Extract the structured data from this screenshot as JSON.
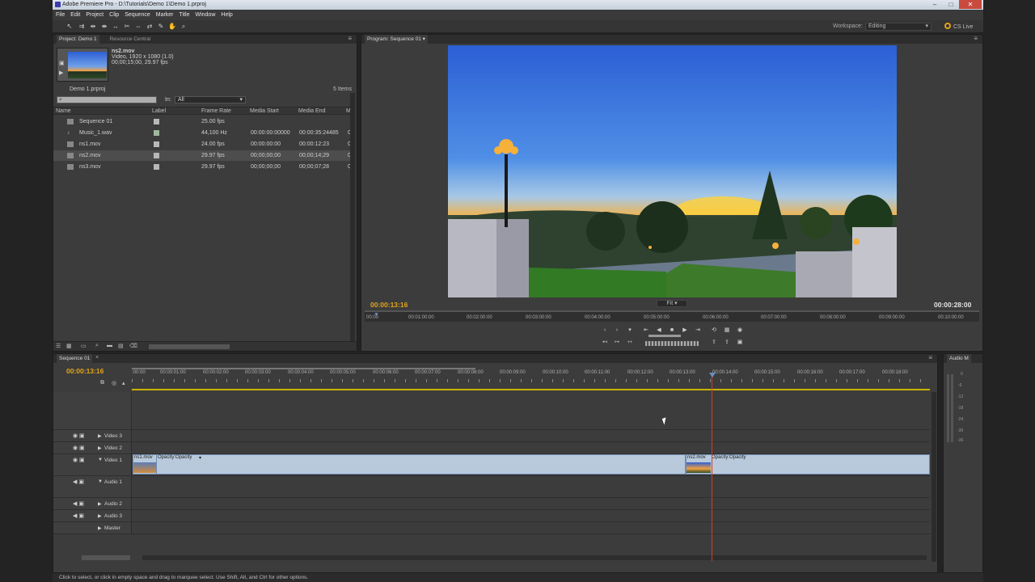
{
  "window": {
    "title": "Adobe Premiere Pro - D:\\Tutorials\\Demo 1\\Demo 1.prproj"
  },
  "menu": [
    "File",
    "Edit",
    "Project",
    "Clip",
    "Sequence",
    "Marker",
    "Title",
    "Window",
    "Help"
  ],
  "workspace": {
    "label": "Workspace:",
    "value": "Editing",
    "cs_live": "CS Live"
  },
  "project": {
    "tabs": [
      "Project: Demo 1",
      "Resource Central"
    ],
    "clip_info": {
      "name": "ns2.mov",
      "line1": "Video, 1920 x 1080 (1.0)",
      "line2": "00;00;15;00, 29.97 fps"
    },
    "project_file": "Demo 1.prproj",
    "item_count": "5 Items",
    "in_label": "In:",
    "in_value": "All",
    "columns": [
      "Name",
      "Label",
      "Frame Rate",
      "Media Start",
      "Media End",
      "M"
    ],
    "rows": [
      {
        "name": "Sequence 01",
        "rate": "25.00 fps",
        "start": "",
        "end": "",
        "m": ""
      },
      {
        "name": "Music_1.wav",
        "rate": "44,100 Hz",
        "start": "00:00:00:00000",
        "end": "00:00:35:24485",
        "m": "0"
      },
      {
        "name": "ns1.mov",
        "rate": "24.00 fps",
        "start": "00:00:00:00",
        "end": "00:00:12:23",
        "m": "0"
      },
      {
        "name": "ns2.mov",
        "rate": "29.97 fps",
        "start": "00;00;00;00",
        "end": "00;00;14;29",
        "m": "0"
      },
      {
        "name": "ns3.mov",
        "rate": "29.97 fps",
        "start": "00;00;00;00",
        "end": "00;00;07;28",
        "m": "0"
      }
    ]
  },
  "program": {
    "tab": "Program: Sequence 01",
    "timecode_current": "00:00:13:16",
    "timecode_duration": "00:00:28:00",
    "fit": "Fit",
    "ruler": [
      "00:00",
      "00:01:00:00",
      "00:02:00:00",
      "00:03:00:00",
      "00:04:00:00",
      "00:05:00:00",
      "00:06:00:00",
      "00:07:00:00",
      "00:08:00:00",
      "00:09:00:00",
      "00:10:00:00"
    ]
  },
  "sequence": {
    "tab": "Sequence 01",
    "timecode": "00:00:13:16",
    "ruler": [
      ":00:00",
      "00:00:01:00",
      "00:00:02:00",
      "00:00:03:00",
      "00:00:04:00",
      "00:00:05:00",
      "00:00:06:00",
      "00:00:07:00",
      "00:00:08:00",
      "00:00:09:00",
      "00:00:10:00",
      "00:00:11:00",
      "00:00:12:00",
      "00:00:13:00",
      "00:00:14:00",
      "00:00:15:00",
      "00:00:16:00",
      "00:00:17:00",
      "00:00:18:00"
    ],
    "tracks": [
      "Video 3",
      "Video 2",
      "Video 1",
      "Audio 1",
      "Audio 2",
      "Audio 3",
      "Master"
    ],
    "clips": [
      {
        "name": "ns1.mov",
        "effect": "Opacity:Opacity"
      },
      {
        "name": "ns2.mov",
        "effect": "Opacity:Opacity"
      }
    ]
  },
  "audio_meter": {
    "tab": "Audio M",
    "scale": [
      "0",
      "-6",
      "-12",
      "-18",
      "-24",
      "-30",
      "-36"
    ]
  },
  "status_text": "Click to select, or click in empty space and drag to marquee select. Use Shift, Alt, and Ctrl for other options."
}
